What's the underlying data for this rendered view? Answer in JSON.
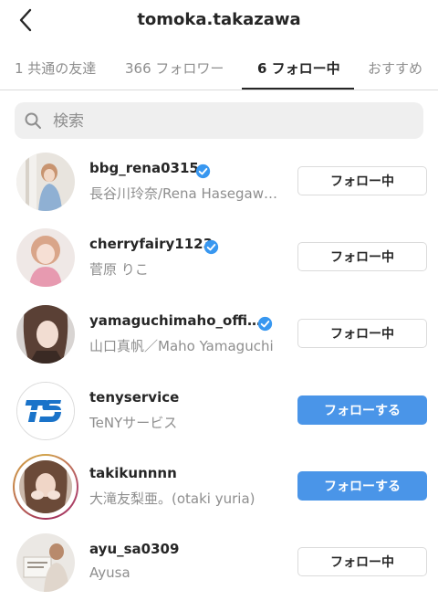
{
  "header": {
    "title": "tomoka.takazawa"
  },
  "tabs": [
    {
      "label": "1 共通の友達"
    },
    {
      "label": "366 フォロワー"
    },
    {
      "label": "6 フォロー中"
    },
    {
      "label": "おすすめ"
    }
  ],
  "search": {
    "placeholder": "検索"
  },
  "users": [
    {
      "username": "bbg_rena0315",
      "full_name": "長谷川玲奈/Rena Hasegaw…",
      "verified": true,
      "button": "フォロー中"
    },
    {
      "username": "cherryfairy1123",
      "full_name": "菅原 りこ",
      "verified": true,
      "button": "フォロー中"
    },
    {
      "username": "yamaguchimaho_offi…",
      "full_name": "山口真帆／Maho Yamaguchi",
      "verified": true,
      "button": "フォロー中"
    },
    {
      "username": "tenyservice",
      "full_name": "TeNYサービス",
      "verified": false,
      "button": "フォローする"
    },
    {
      "username": "takikunnnn",
      "full_name": "大滝友梨亜。(otaki yuria)",
      "verified": false,
      "button": "フォローする"
    },
    {
      "username": "ayu_sa0309",
      "full_name": "Ayusa",
      "verified": false,
      "button": "フォロー中"
    }
  ],
  "colors": {
    "primary": "#4a95e8",
    "text": "#262626",
    "secondary": "#8e8e8e",
    "verified": "#3897f0"
  }
}
